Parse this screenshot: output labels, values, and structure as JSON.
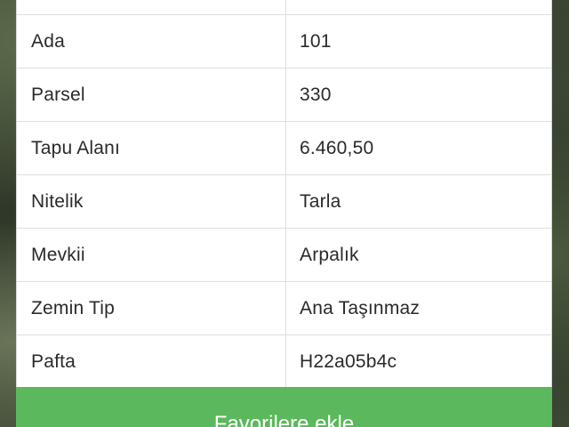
{
  "table": {
    "rows": [
      {
        "label": "",
        "value": ""
      },
      {
        "label": "Ada",
        "value": "101"
      },
      {
        "label": "Parsel",
        "value": "330"
      },
      {
        "label": "Tapu Alanı",
        "value": "6.460,50"
      },
      {
        "label": "Nitelik",
        "value": "Tarla"
      },
      {
        "label": "Mevkii",
        "value": "Arpalık"
      },
      {
        "label": "Zemin Tip",
        "value": "Ana Taşınmaz"
      },
      {
        "label": "Pafta",
        "value": "H22a05b4c"
      }
    ]
  },
  "actions": {
    "favorite_label": "Favorilere ekle"
  },
  "colors": {
    "button_green": "#5cb85c",
    "card_bg": "#ffffff",
    "border": "#dedede"
  }
}
